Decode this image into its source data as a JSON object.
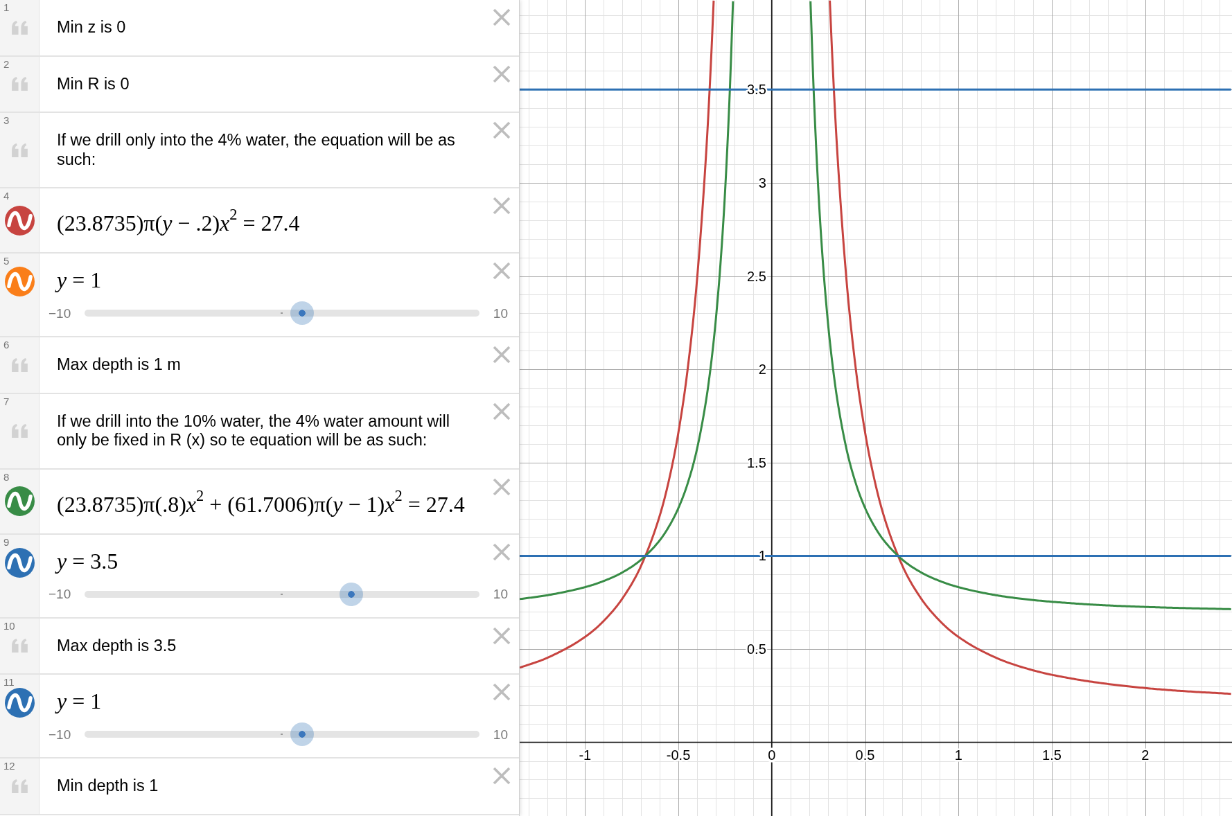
{
  "expressions": [
    {
      "number": "1",
      "kind": "note",
      "text": "Min z is 0"
    },
    {
      "number": "2",
      "kind": "note",
      "text": "Min R is 0"
    },
    {
      "number": "3",
      "kind": "note",
      "text": "If we drill only into the 4% water, the equation will be as such:"
    },
    {
      "number": "4",
      "kind": "equation",
      "color": "#c74440",
      "text": "(23.8735)π(*y* − .2)*x*$^{2}$ = 27.4"
    },
    {
      "number": "5",
      "kind": "slider",
      "color": "#fa7e19",
      "text": "*y* = 1",
      "slider": {
        "min": "−10",
        "max": "10",
        "level": 0.55
      }
    },
    {
      "number": "6",
      "kind": "note",
      "text": "Max depth is 1 m"
    },
    {
      "number": "7",
      "kind": "note",
      "text": "If we drill into the 10% water, the 4% water amount will only be fixed in R (x) so te equation will be as such:"
    },
    {
      "number": "8",
      "kind": "equation",
      "color": "#388c46",
      "text": "(23.8735)π(.8)*x*$^{2}$ + (61.7006)π(*y* − 1)*x*$^{2}$ = 27.4"
    },
    {
      "number": "9",
      "kind": "slider",
      "color": "#2d70b3",
      "text": "*y* = 3.5",
      "slider": {
        "min": "−10",
        "max": "10",
        "level": 0.675
      }
    },
    {
      "number": "10",
      "kind": "note",
      "text": "Max depth is 3.5"
    },
    {
      "number": "11",
      "kind": "slider",
      "color": "#2d70b3",
      "text": "*y* = 1",
      "slider": {
        "min": "−10",
        "max": "10",
        "level": 0.55
      }
    },
    {
      "number": "12",
      "kind": "note",
      "text": "Min depth is 1"
    }
  ],
  "graph": {
    "chart_data": {
      "type": "line",
      "grid": true,
      "xlim": [
        -1.35,
        2.465
      ],
      "ylim": [
        -0.395,
        3.98
      ],
      "xticks": [
        -1,
        -0.5,
        0,
        0.5,
        1,
        1.5,
        2
      ],
      "yticks": [
        0.5,
        1,
        1.5,
        2,
        2.5,
        3,
        3.5
      ],
      "x": [
        -1.35,
        -1.2,
        -1.0,
        -0.9,
        -0.8,
        -0.7,
        -0.6,
        -0.55,
        -0.5,
        -0.45,
        -0.4,
        -0.35,
        -0.325,
        -0.311,
        -0.3,
        -0.275,
        -0.25,
        -0.225,
        -0.2075,
        0,
        0.2075,
        0.225,
        0.25,
        0.275,
        0.3,
        0.311,
        0.325,
        0.35,
        0.4,
        0.45,
        0.5,
        0.55,
        0.6,
        0.7,
        0.8,
        0.9,
        1.0,
        1.2,
        1.4,
        1.6,
        1.8,
        2.0,
        2.2,
        2.46
      ],
      "series": [
        {
          "color": "#c74440",
          "values": [
            0.4,
            0.454,
            0.565,
            0.651,
            0.771,
            0.946,
            1.215,
            1.408,
            1.661,
            2.004,
            2.483,
            3.182,
            3.659,
            3.977,
            null,
            null,
            null,
            null,
            null,
            null,
            null,
            null,
            null,
            null,
            null,
            3.977,
            3.659,
            3.182,
            2.483,
            2.004,
            1.661,
            1.408,
            1.215,
            0.946,
            0.771,
            0.651,
            0.565,
            0.454,
            0.386,
            0.343,
            0.313,
            0.291,
            0.275,
            0.26
          ]
        },
        {
          "color": "#388c46",
          "values": [
            0.768,
            0.789,
            0.832,
            0.865,
            0.911,
            0.979,
            1.083,
            1.158,
            1.256,
            1.389,
            1.574,
            1.844,
            2.029,
            2.152,
            2.261,
            2.56,
            2.952,
            3.483,
            3.973,
            null,
            3.973,
            3.483,
            2.952,
            2.56,
            2.261,
            2.152,
            2.029,
            1.844,
            1.574,
            1.389,
            1.256,
            1.158,
            1.083,
            0.979,
            0.911,
            0.865,
            0.832,
            0.789,
            0.763,
            0.746,
            0.734,
            0.726,
            0.72,
            0.714
          ]
        },
        {
          "color": "#2d70b3",
          "values": [
            3.5,
            3.5,
            3.5,
            3.5,
            3.5,
            3.5,
            3.5,
            3.5,
            3.5,
            3.5,
            3.5,
            3.5,
            3.5,
            3.5,
            3.5,
            3.5,
            3.5,
            3.5,
            3.5,
            3.5,
            3.5,
            3.5,
            3.5,
            3.5,
            3.5,
            3.5,
            3.5,
            3.5,
            3.5,
            3.5,
            3.5,
            3.5,
            3.5,
            3.5,
            3.5,
            3.5,
            3.5,
            3.5,
            3.5,
            3.5,
            3.5,
            3.5,
            3.5,
            3.5
          ]
        },
        {
          "color": "#2d70b3",
          "values": [
            1,
            1,
            1,
            1,
            1,
            1,
            1,
            1,
            1,
            1,
            1,
            1,
            1,
            1,
            1,
            1,
            1,
            1,
            1,
            1,
            1,
            1,
            1,
            1,
            1,
            1,
            1,
            1,
            1,
            1,
            1,
            1,
            1,
            1,
            1,
            1,
            1,
            1,
            1,
            1,
            1,
            1,
            1,
            1
          ]
        }
      ]
    }
  }
}
